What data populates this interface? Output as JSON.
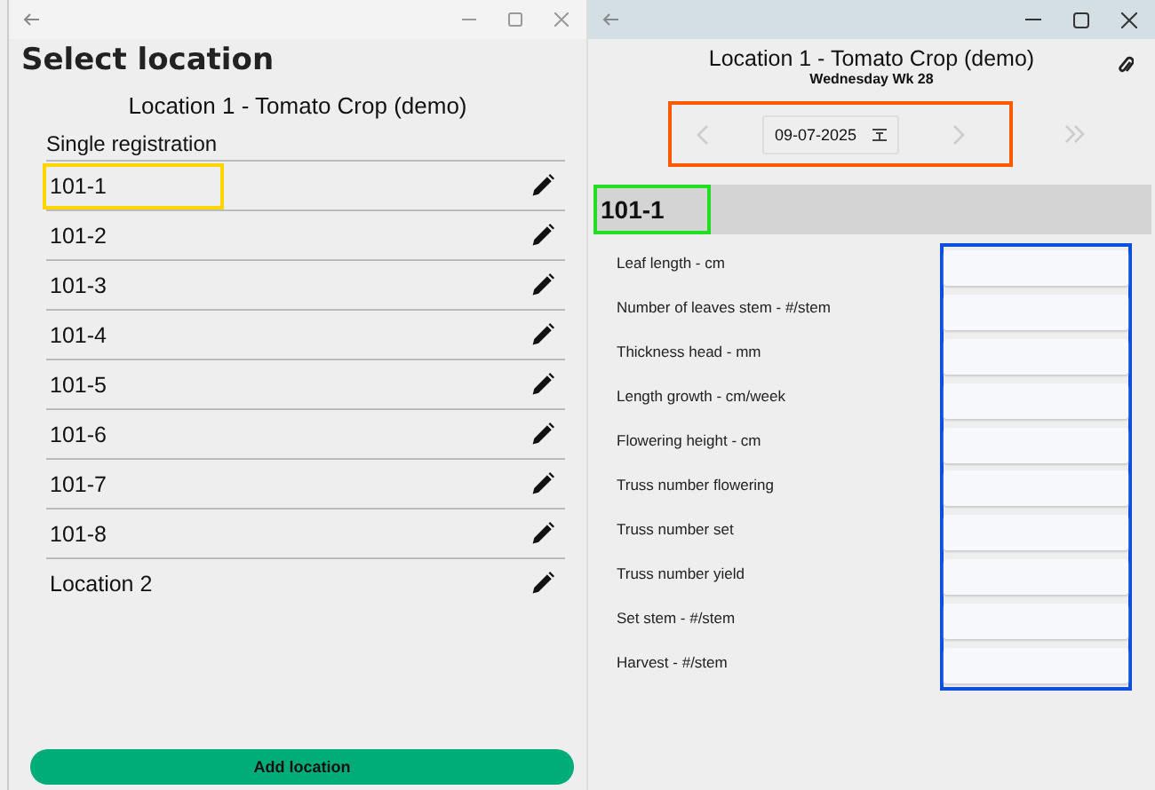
{
  "left_window": {
    "title": "Select location",
    "subtitle": "Location 1 - Tomato Crop (demo)",
    "section": "Single registration",
    "locations": [
      {
        "name": "101-1",
        "color": "#ffd600"
      },
      {
        "name": "101-2"
      },
      {
        "name": "101-3"
      },
      {
        "name": "101-4"
      },
      {
        "name": "101-5"
      },
      {
        "name": "101-6"
      },
      {
        "name": "101-7"
      },
      {
        "name": "101-8"
      },
      {
        "name": "Location 2"
      }
    ],
    "add_button": "Add location"
  },
  "right_window": {
    "title": "Location 1 - Tomato Crop (demo)",
    "subtitle": "Wednesday Wk 28",
    "date_nav": {
      "date": "09-07-2025",
      "color": "#ff5a00"
    },
    "section": {
      "label": "101-1",
      "color": "#22dd22"
    },
    "input_column": {
      "color": "#0a4fe0"
    },
    "fields": [
      {
        "label": "Leaf length - cm"
      },
      {
        "label": "Number of leaves stem - #/stem"
      },
      {
        "label": "Thickness head - mm"
      },
      {
        "label": "Length growth - cm/week"
      },
      {
        "label": "Flowering height - cm"
      },
      {
        "label": "Truss number flowering"
      },
      {
        "label": "Truss number set"
      },
      {
        "label": "Truss number yield"
      },
      {
        "label": "Set stem - #/stem"
      },
      {
        "label": "Harvest - #/stem"
      }
    ]
  }
}
